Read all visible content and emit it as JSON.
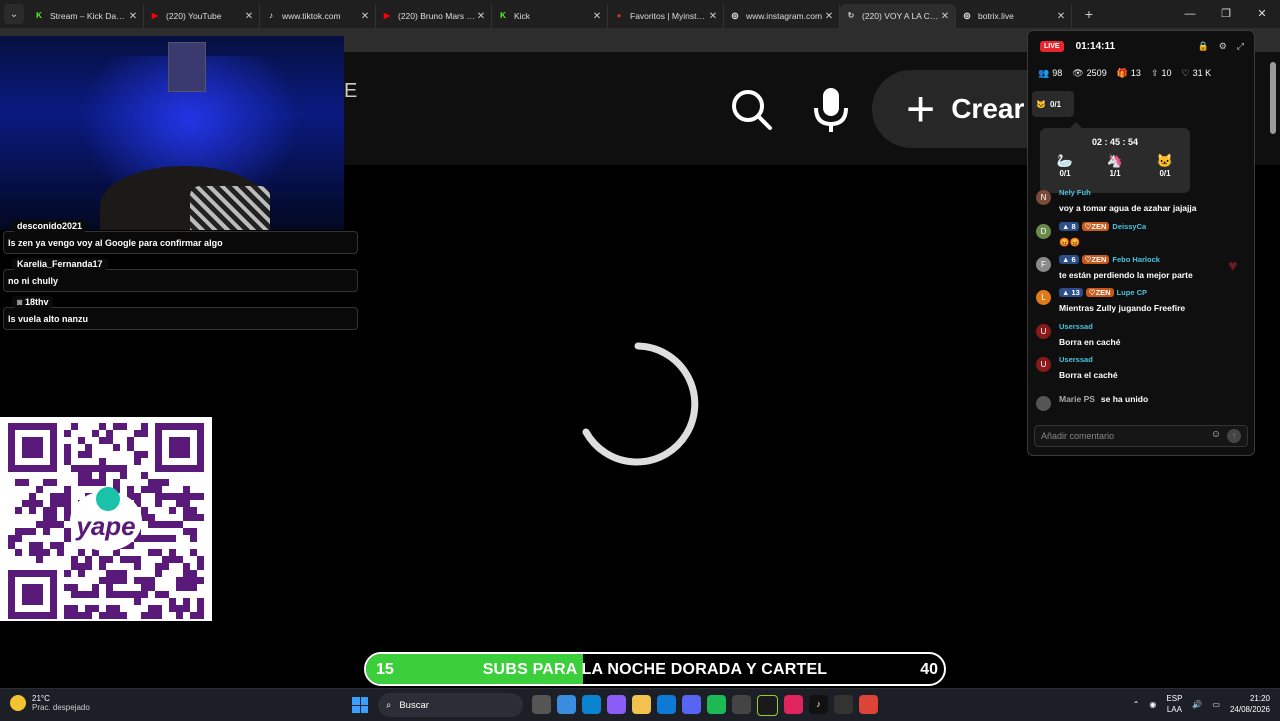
{
  "tabs": [
    {
      "title": "Stream – Kick Dashboard",
      "fav": "K",
      "color": "#53fc18",
      "active": false
    },
    {
      "title": "(220) YouTube",
      "fav": "▶",
      "color": "#ff0000",
      "active": false
    },
    {
      "title": "www.tiktok.com",
      "fav": "♪",
      "color": "#ffffff",
      "active": false
    },
    {
      "title": "(220) Bruno Mars - Talking",
      "fav": "▶",
      "color": "#ff0000",
      "active": false
    },
    {
      "title": "Kick",
      "fav": "K",
      "color": "#53fc18",
      "active": false
    },
    {
      "title": "Favoritos | Myinstants",
      "fav": "●",
      "color": "#c0392b",
      "active": false
    },
    {
      "title": "www.instagram.com",
      "fav": "◎",
      "color": "#ffffff",
      "active": false
    },
    {
      "title": "(220) VOY A LA CASA de",
      "fav": "↻",
      "color": "#cccccc",
      "active": true
    },
    {
      "title": "botrix.live",
      "fav": "◎",
      "color": "#ffffff",
      "active": false
    }
  ],
  "youtube": {
    "partial_logo": "E",
    "create_label": "Crear",
    "notif_count": "9+"
  },
  "overlay_chat": [
    {
      "user": "desconido2021",
      "user_color": "#ff4d4d",
      "message": "ls zen ya vengo voy al Google para confirmar algo"
    },
    {
      "user": "Karelia_Fernanda17",
      "user_color": "#e0245e",
      "message": "no ni chully"
    },
    {
      "user": "18thv",
      "user_color": "#ff7ab8",
      "message": "ls vuela alto nanzu"
    }
  ],
  "qr": {
    "brand": "yape"
  },
  "panel": {
    "live_label": "LIVE",
    "timer": "01:14:11",
    "stats": {
      "viewers": "98",
      "views": "2509",
      "gifts": "13",
      "shares": "10",
      "likes": "31 K"
    },
    "goal_left": "0/1",
    "popup_timer": "02 : 45 : 54",
    "popup_items": [
      "0/1",
      "1/1",
      "0/1"
    ],
    "messages": [
      {
        "name": "Nely Fuh",
        "lvl": "",
        "zen": false,
        "text": "voy a tomar agua de azahar jajajja",
        "avatar": "N",
        "avatar_color": "#7a4a3a"
      },
      {
        "name": "DeissyCa",
        "lvl": "8",
        "zen": true,
        "text": "😡😡",
        "avatar": "D",
        "avatar_color": "#6a8a4a"
      },
      {
        "name": "Febo Harlock",
        "lvl": "6",
        "zen": true,
        "text": "te están perdiendo la mejor parte",
        "avatar": "F",
        "avatar_color": "#8a8a8a"
      },
      {
        "name": "Lupe CP",
        "lvl": "13",
        "zen": true,
        "text": "Mientras Zully jugando Freefire",
        "avatar": "L",
        "avatar_color": "#e07b1a"
      },
      {
        "name": "Userssad",
        "lvl": "",
        "zen": false,
        "text": "Borra en caché",
        "avatar": "U",
        "avatar_color": "#8a1a1a"
      },
      {
        "name": "Userssad",
        "lvl": "",
        "zen": false,
        "text": "Borra el caché",
        "avatar": "U",
        "avatar_color": "#8a1a1a"
      }
    ],
    "join": {
      "name": "Marie PS",
      "text": "se ha unido"
    },
    "comment_placeholder": "Añadir comentario"
  },
  "subs_bar": {
    "current": "15",
    "label": "SUBS PARA LA NOCHE DORADA Y CARTEL",
    "goal": "40",
    "progress": 0.375
  },
  "taskbar": {
    "temp": "21°C",
    "weather": "Prac. despejado",
    "search_label": "Buscar",
    "lang1": "ESP",
    "lang2": "LAA",
    "time": "21:20",
    "date": "24/08/2026"
  }
}
